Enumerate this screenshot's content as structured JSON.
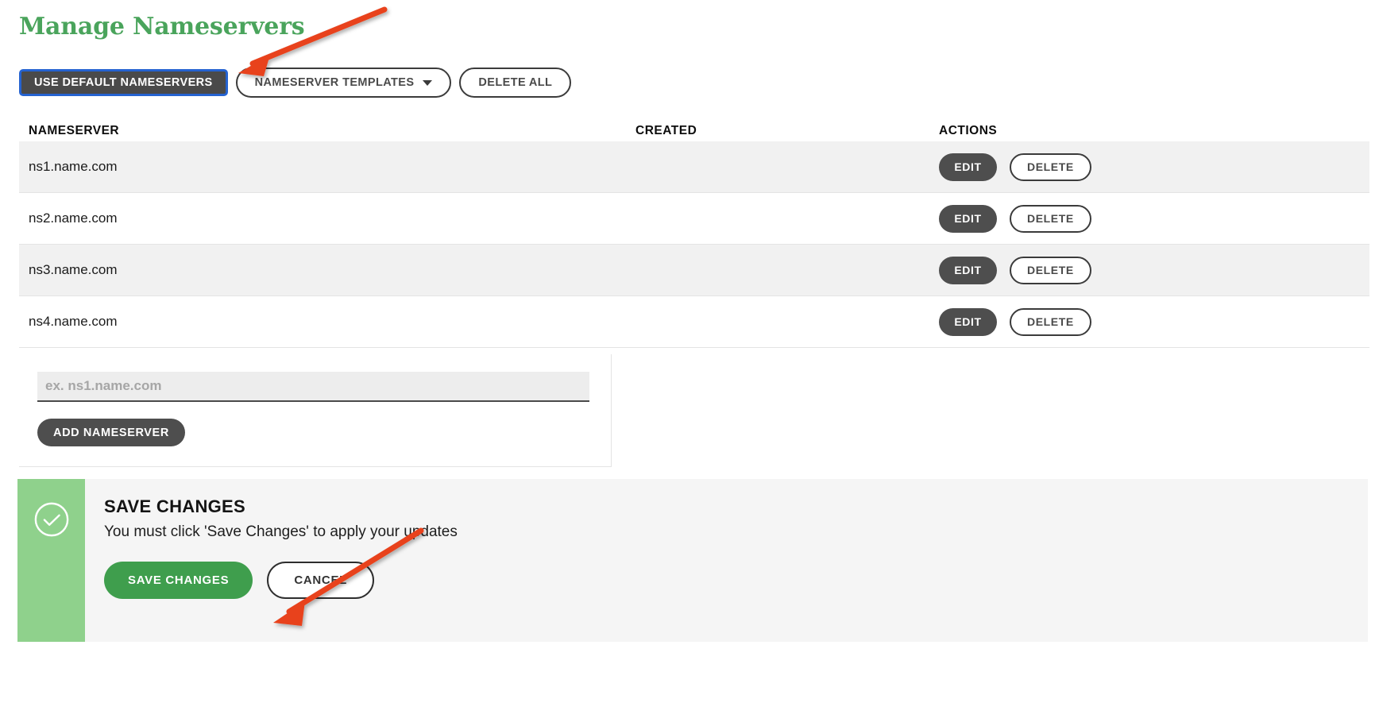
{
  "page": {
    "title": "Manage Nameservers",
    "title_color": "#4aa45c"
  },
  "toolbar": {
    "use_default_label": "USE DEFAULT NAMESERVERS",
    "templates_label": "NAMESERVER TEMPLATES",
    "delete_all_label": "DELETE ALL",
    "focus_ring_color": "#2563d1"
  },
  "table": {
    "headers": {
      "nameserver": "NAMESERVER",
      "created": "CREATED",
      "actions": "ACTIONS"
    },
    "rows": [
      {
        "nameserver": "ns1.name.com",
        "created": "",
        "edit_label": "EDIT",
        "delete_label": "DELETE"
      },
      {
        "nameserver": "ns2.name.com",
        "created": "",
        "edit_label": "EDIT",
        "delete_label": "DELETE"
      },
      {
        "nameserver": "ns3.name.com",
        "created": "",
        "edit_label": "EDIT",
        "delete_label": "DELETE"
      },
      {
        "nameserver": "ns4.name.com",
        "created": "",
        "edit_label": "EDIT",
        "delete_label": "DELETE"
      }
    ]
  },
  "add_panel": {
    "input_value": "",
    "input_placeholder": "ex. ns1.name.com",
    "add_label": "ADD NAMESERVER"
  },
  "save_panel": {
    "icon": "check-circle-icon",
    "accent_color": "#8fd18c",
    "title": "SAVE CHANGES",
    "description": "You must click 'Save Changes' to apply your updates",
    "save_label": "SAVE CHANGES",
    "cancel_label": "CANCEL",
    "save_button_color": "#3f9e4d"
  },
  "annotations": {
    "arrow_color": "#e8431f",
    "arrows": [
      {
        "name": "arrow-to-use-default-nameservers",
        "target": "USE DEFAULT NAMESERVERS"
      },
      {
        "name": "arrow-to-save-changes",
        "target": "SAVE CHANGES"
      }
    ]
  }
}
